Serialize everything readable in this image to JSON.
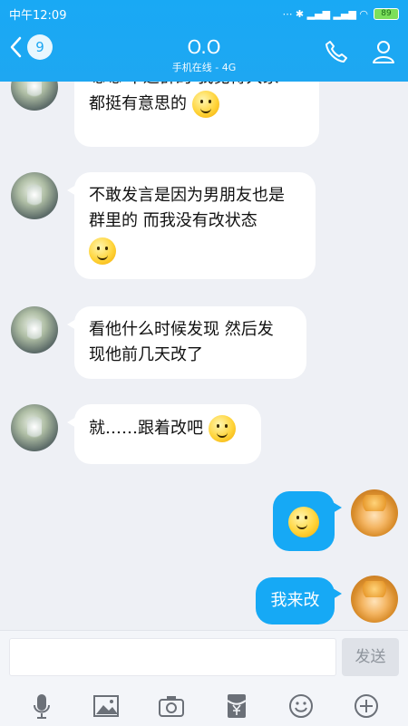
{
  "status": {
    "time": "中午12:09",
    "battery": "89"
  },
  "header": {
    "back_count": "9",
    "title": "O.O",
    "subtitle": "手机在线 - 4G"
  },
  "messages": [
    {
      "side": "in",
      "line1": "嗯嗯 不退群的 我觉得大家",
      "line2": "都挺有意思的"
    },
    {
      "side": "in",
      "line1": "不敢发言是因为男朋友也是",
      "line2": "群里的 而我没有改状态"
    },
    {
      "side": "in",
      "line1": "看他什么时候发现 然后发",
      "line2": "现他前几天改了"
    },
    {
      "side": "in",
      "line1": "就……跟着改吧"
    },
    {
      "side": "out",
      "text": ""
    },
    {
      "side": "out",
      "text": "我来改"
    }
  ],
  "composer": {
    "input_value": "",
    "send_label": "发送"
  },
  "toolbar": [
    "mic-icon",
    "image-icon",
    "camera-icon",
    "red-packet-icon",
    "emoji-icon",
    "plus-icon"
  ],
  "colors": {
    "accent": "#1ea7f2",
    "bubble_out": "#16a9f5"
  }
}
